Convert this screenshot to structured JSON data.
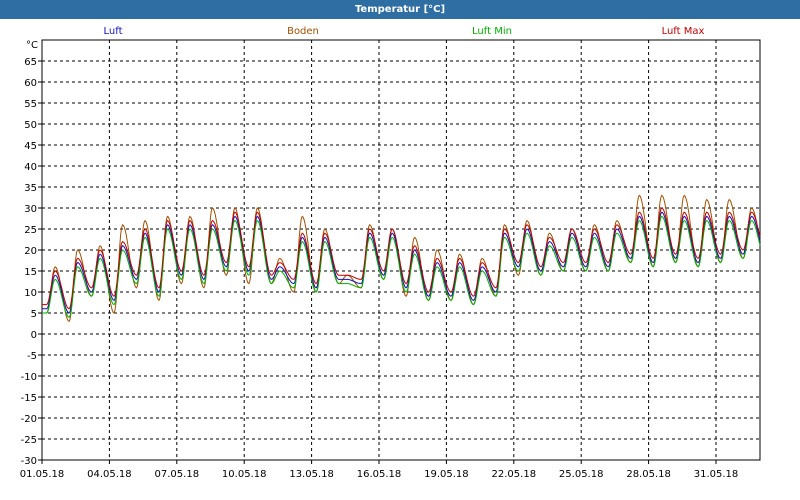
{
  "window": {
    "title": "Temperatur [°C]"
  },
  "chart_data": {
    "type": "line",
    "title": "Temperatur [°C]",
    "ylabel": "°C",
    "xlabel": "",
    "ylim": [
      -30,
      70
    ],
    "yticks": [
      -30,
      -25,
      -20,
      -15,
      -10,
      -5,
      0,
      5,
      10,
      15,
      20,
      25,
      30,
      35,
      40,
      45,
      50,
      55,
      60,
      65
    ],
    "xlim": [
      "2018-05-01",
      "2018-06-01T23:00"
    ],
    "xticks": [
      "01.05.18",
      "04.05.18",
      "07.05.18",
      "10.05.18",
      "13.05.18",
      "16.05.18",
      "19.05.18",
      "22.05.18",
      "25.05.18",
      "28.05.18",
      "31.05.18"
    ],
    "grid": true,
    "legend_position": "top",
    "daily": {
      "dates": [
        "01.05.18",
        "02.05.18",
        "03.05.18",
        "04.05.18",
        "05.05.18",
        "06.05.18",
        "07.05.18",
        "08.05.18",
        "09.05.18",
        "10.05.18",
        "11.05.18",
        "12.05.18",
        "13.05.18",
        "14.05.18",
        "15.05.18",
        "16.05.18",
        "17.05.18",
        "18.05.18",
        "19.05.18",
        "20.05.18",
        "21.05.18",
        "22.05.18",
        "23.05.18",
        "24.05.18",
        "25.05.18",
        "26.05.18",
        "27.05.18",
        "28.05.18",
        "29.05.18",
        "30.05.18",
        "31.05.18",
        "01.06.18"
      ],
      "series": [
        {
          "name": "Luft",
          "color": "#1010c0",
          "min": [
            6,
            5,
            10,
            8,
            13,
            10,
            14,
            13,
            16,
            15,
            13,
            12,
            11,
            13,
            12,
            14,
            11,
            9,
            9,
            8,
            10,
            16,
            15,
            16,
            16,
            16,
            18,
            17,
            18,
            17,
            18,
            19
          ],
          "max": [
            14,
            17,
            19,
            21,
            24,
            26,
            26,
            26,
            28,
            28,
            16,
            23,
            23,
            13,
            24,
            24,
            20,
            17,
            17,
            16,
            24,
            25,
            22,
            24,
            24,
            25,
            28,
            29,
            28,
            28,
            28,
            28
          ]
        },
        {
          "name": "Boden",
          "color": "#a05000",
          "min": [
            5,
            3,
            9,
            5,
            11,
            8,
            12,
            11,
            14,
            12,
            12,
            10,
            10,
            12,
            11,
            13,
            9,
            8,
            8,
            7,
            9,
            14,
            14,
            15,
            15,
            15,
            17,
            16,
            17,
            16,
            17,
            18
          ],
          "max": [
            16,
            20,
            21,
            26,
            27,
            28,
            28,
            30,
            30,
            30,
            18,
            28,
            25,
            14,
            26,
            25,
            23,
            20,
            19,
            18,
            26,
            27,
            24,
            25,
            26,
            27,
            33,
            33,
            33,
            32,
            32,
            30
          ]
        },
        {
          "name": "Luft Min",
          "color": "#00b000",
          "min": [
            5,
            4,
            9,
            7,
            12,
            9,
            13,
            12,
            15,
            14,
            12,
            11,
            10,
            12,
            11,
            13,
            10,
            8,
            8,
            7,
            9,
            15,
            14,
            15,
            15,
            15,
            17,
            16,
            17,
            16,
            17,
            18
          ],
          "max": [
            13,
            16,
            18,
            20,
            23,
            25,
            25,
            25,
            27,
            27,
            15,
            22,
            22,
            12,
            23,
            23,
            19,
            16,
            16,
            15,
            23,
            24,
            21,
            23,
            23,
            24,
            27,
            28,
            27,
            27,
            27,
            27
          ]
        },
        {
          "name": "Luft Max",
          "color": "#c00000",
          "min": [
            7,
            6,
            11,
            9,
            14,
            11,
            15,
            14,
            17,
            16,
            14,
            13,
            12,
            14,
            13,
            15,
            12,
            10,
            10,
            9,
            11,
            17,
            16,
            17,
            17,
            17,
            19,
            18,
            19,
            18,
            19,
            20
          ],
          "max": [
            15,
            18,
            20,
            22,
            25,
            27,
            27,
            27,
            29,
            29,
            17,
            24,
            24,
            14,
            25,
            25,
            21,
            18,
            18,
            17,
            25,
            26,
            23,
            25,
            25,
            26,
            29,
            30,
            29,
            29,
            29,
            29
          ]
        }
      ]
    }
  }
}
